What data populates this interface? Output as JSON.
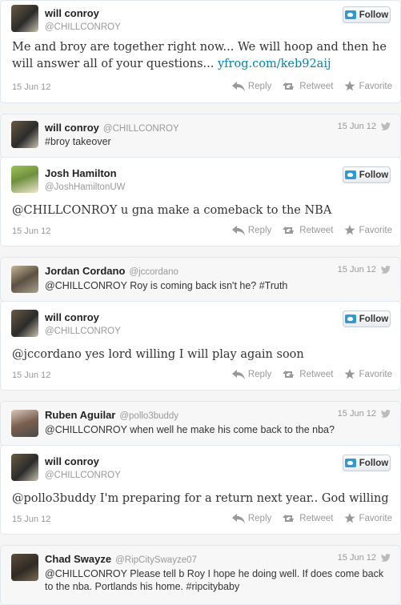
{
  "actions": {
    "reply": "Reply",
    "retweet": "Retweet",
    "favorite": "Favorite"
  },
  "follow_label": "Follow",
  "tweets": [
    {
      "name": "will conroy",
      "handle": "@CHILLCONROY",
      "text": "Me and broy are together right now... We will hoop and then he will answer all of your questions...",
      "link": "yfrog.com/keb92aij",
      "date": "15 Jun 12"
    },
    {
      "name": "will conroy",
      "handle": "@CHILLCONROY",
      "text": "#broy takeover",
      "date": "15 Jun 12"
    },
    {
      "name": "Josh Hamilton",
      "handle": "@JoshHamiltonUW",
      "text": "@CHILLCONROY u gna make a comeback to the NBA",
      "date": "15 Jun 12"
    },
    {
      "name": "Jordan Cordano",
      "handle": "@jccordano",
      "text": "@CHILLCONROY Roy is coming back isn't he? #Truth",
      "date": "15 Jun 12"
    },
    {
      "name": "will conroy",
      "handle": "@CHILLCONROY",
      "text": "@jccordano yes lord willing I will play again soon",
      "date": "15 Jun 12"
    },
    {
      "name": "Ruben Aguilar",
      "handle": "@pollo3buddy",
      "text": "@CHILLCONROY when well he make his come back to the nba?",
      "date": "15 Jun 12"
    },
    {
      "name": "will conroy",
      "handle": "@CHILLCONROY",
      "text": "@pollo3buddy I'm preparing for a return next year.. God willing",
      "date": "15 Jun 12"
    },
    {
      "name": "Chad Swayze",
      "handle": "@RipCitySwayze07",
      "text": "@CHILLCONROY Please tell b Roy I hope he doing well. If does come back to the nba. Portlands his home. #ripcitybaby",
      "date": "15 Jun 12"
    }
  ]
}
